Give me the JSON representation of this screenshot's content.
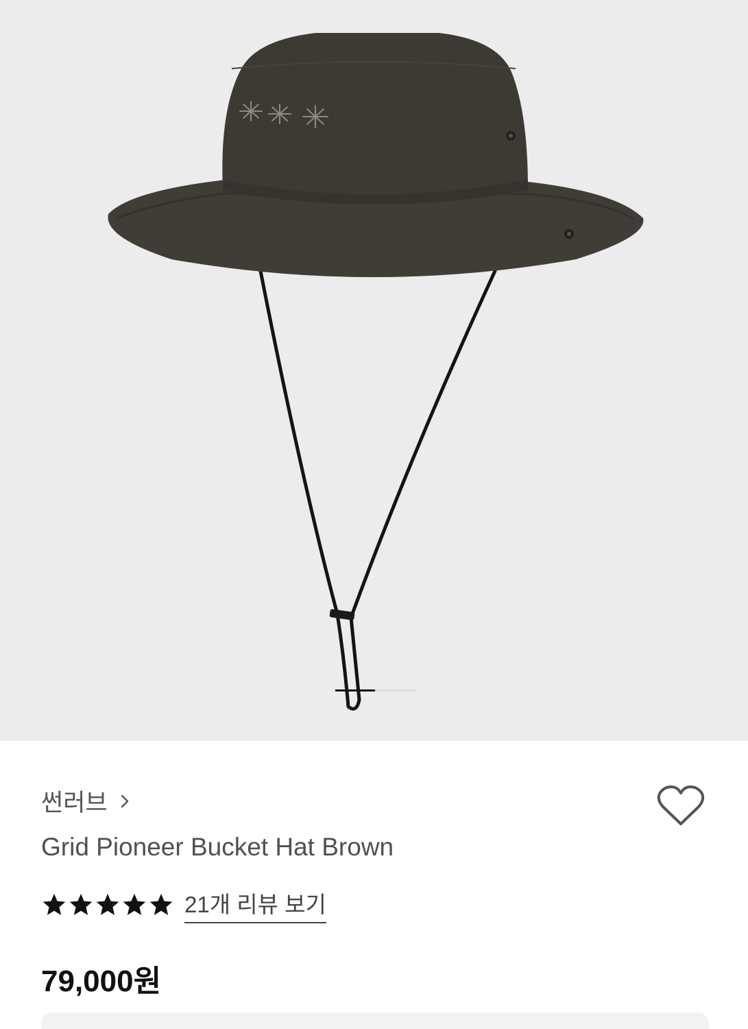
{
  "product": {
    "brand": "썬러브",
    "title": "Grid Pioneer Bucket Hat Brown",
    "rating_stars": 5,
    "review_link": "21개 리뷰 보기",
    "price": "79,000원"
  },
  "gallery": {
    "current_slide_fraction": 0.5
  },
  "icons": {
    "brand_chevron": "chevron-right-icon",
    "wishlist": "heart-outline-icon",
    "rating": "star-icon"
  },
  "colors": {
    "hero_background": "#ececec",
    "hat": "#3c3a33",
    "text_primary": "#111111",
    "text_secondary": "#555555"
  }
}
